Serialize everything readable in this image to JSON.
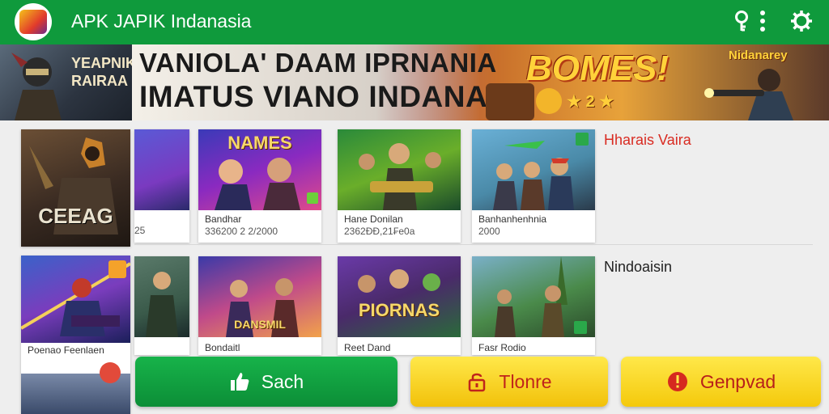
{
  "app": {
    "title": "APK JAPIK Indanasia",
    "top_icons": [
      "key-icon",
      "more-vert-icon",
      "settings-gear-icon"
    ]
  },
  "banner": {
    "left_text": "YEAPNIK RAIRAA",
    "line1": "VANIOLA' DAAM IPRNANIA",
    "line2": "IMATUS VIANO INDANANS",
    "bonus": "BOMES!",
    "bonus_sub": "★ 2 ★",
    "right_tag": "Nidanarey"
  },
  "sidebar_cards": [
    {
      "art_text": "CEEAG",
      "label": ""
    },
    {
      "art_text": "",
      "label": "Poenao Feenlaen"
    }
  ],
  "row1": {
    "section_title": "Hharais Vaira",
    "section_color": "#d92b22",
    "cards": [
      {
        "title": "",
        "sub": "25"
      },
      {
        "title": "Bandhar",
        "sub": "336200 2 2/2000",
        "art_text": "NAMES"
      },
      {
        "title": "Hane Donilan",
        "sub": "2362ÐÐ,21₣e0a"
      },
      {
        "title": "Banhanhenhnia",
        "sub": "2000"
      }
    ]
  },
  "row2": {
    "section_title": "Nindoaisin",
    "section_color": "#222222",
    "cards": [
      {
        "title": "",
        "sub": ""
      },
      {
        "title": "Bondaitl",
        "sub": "",
        "art_text": "DANSMIL"
      },
      {
        "title": "Reet Dand",
        "sub": "",
        "art_text": "PIORNAS"
      },
      {
        "title": "Fasr Rodio",
        "sub": ""
      }
    ]
  },
  "actions": [
    {
      "label": "Sach",
      "icon": "thumbs-up-icon"
    },
    {
      "label": "Tlonre",
      "icon": "lock-icon"
    },
    {
      "label": "Genpvad",
      "icon": "alert-icon"
    }
  ]
}
